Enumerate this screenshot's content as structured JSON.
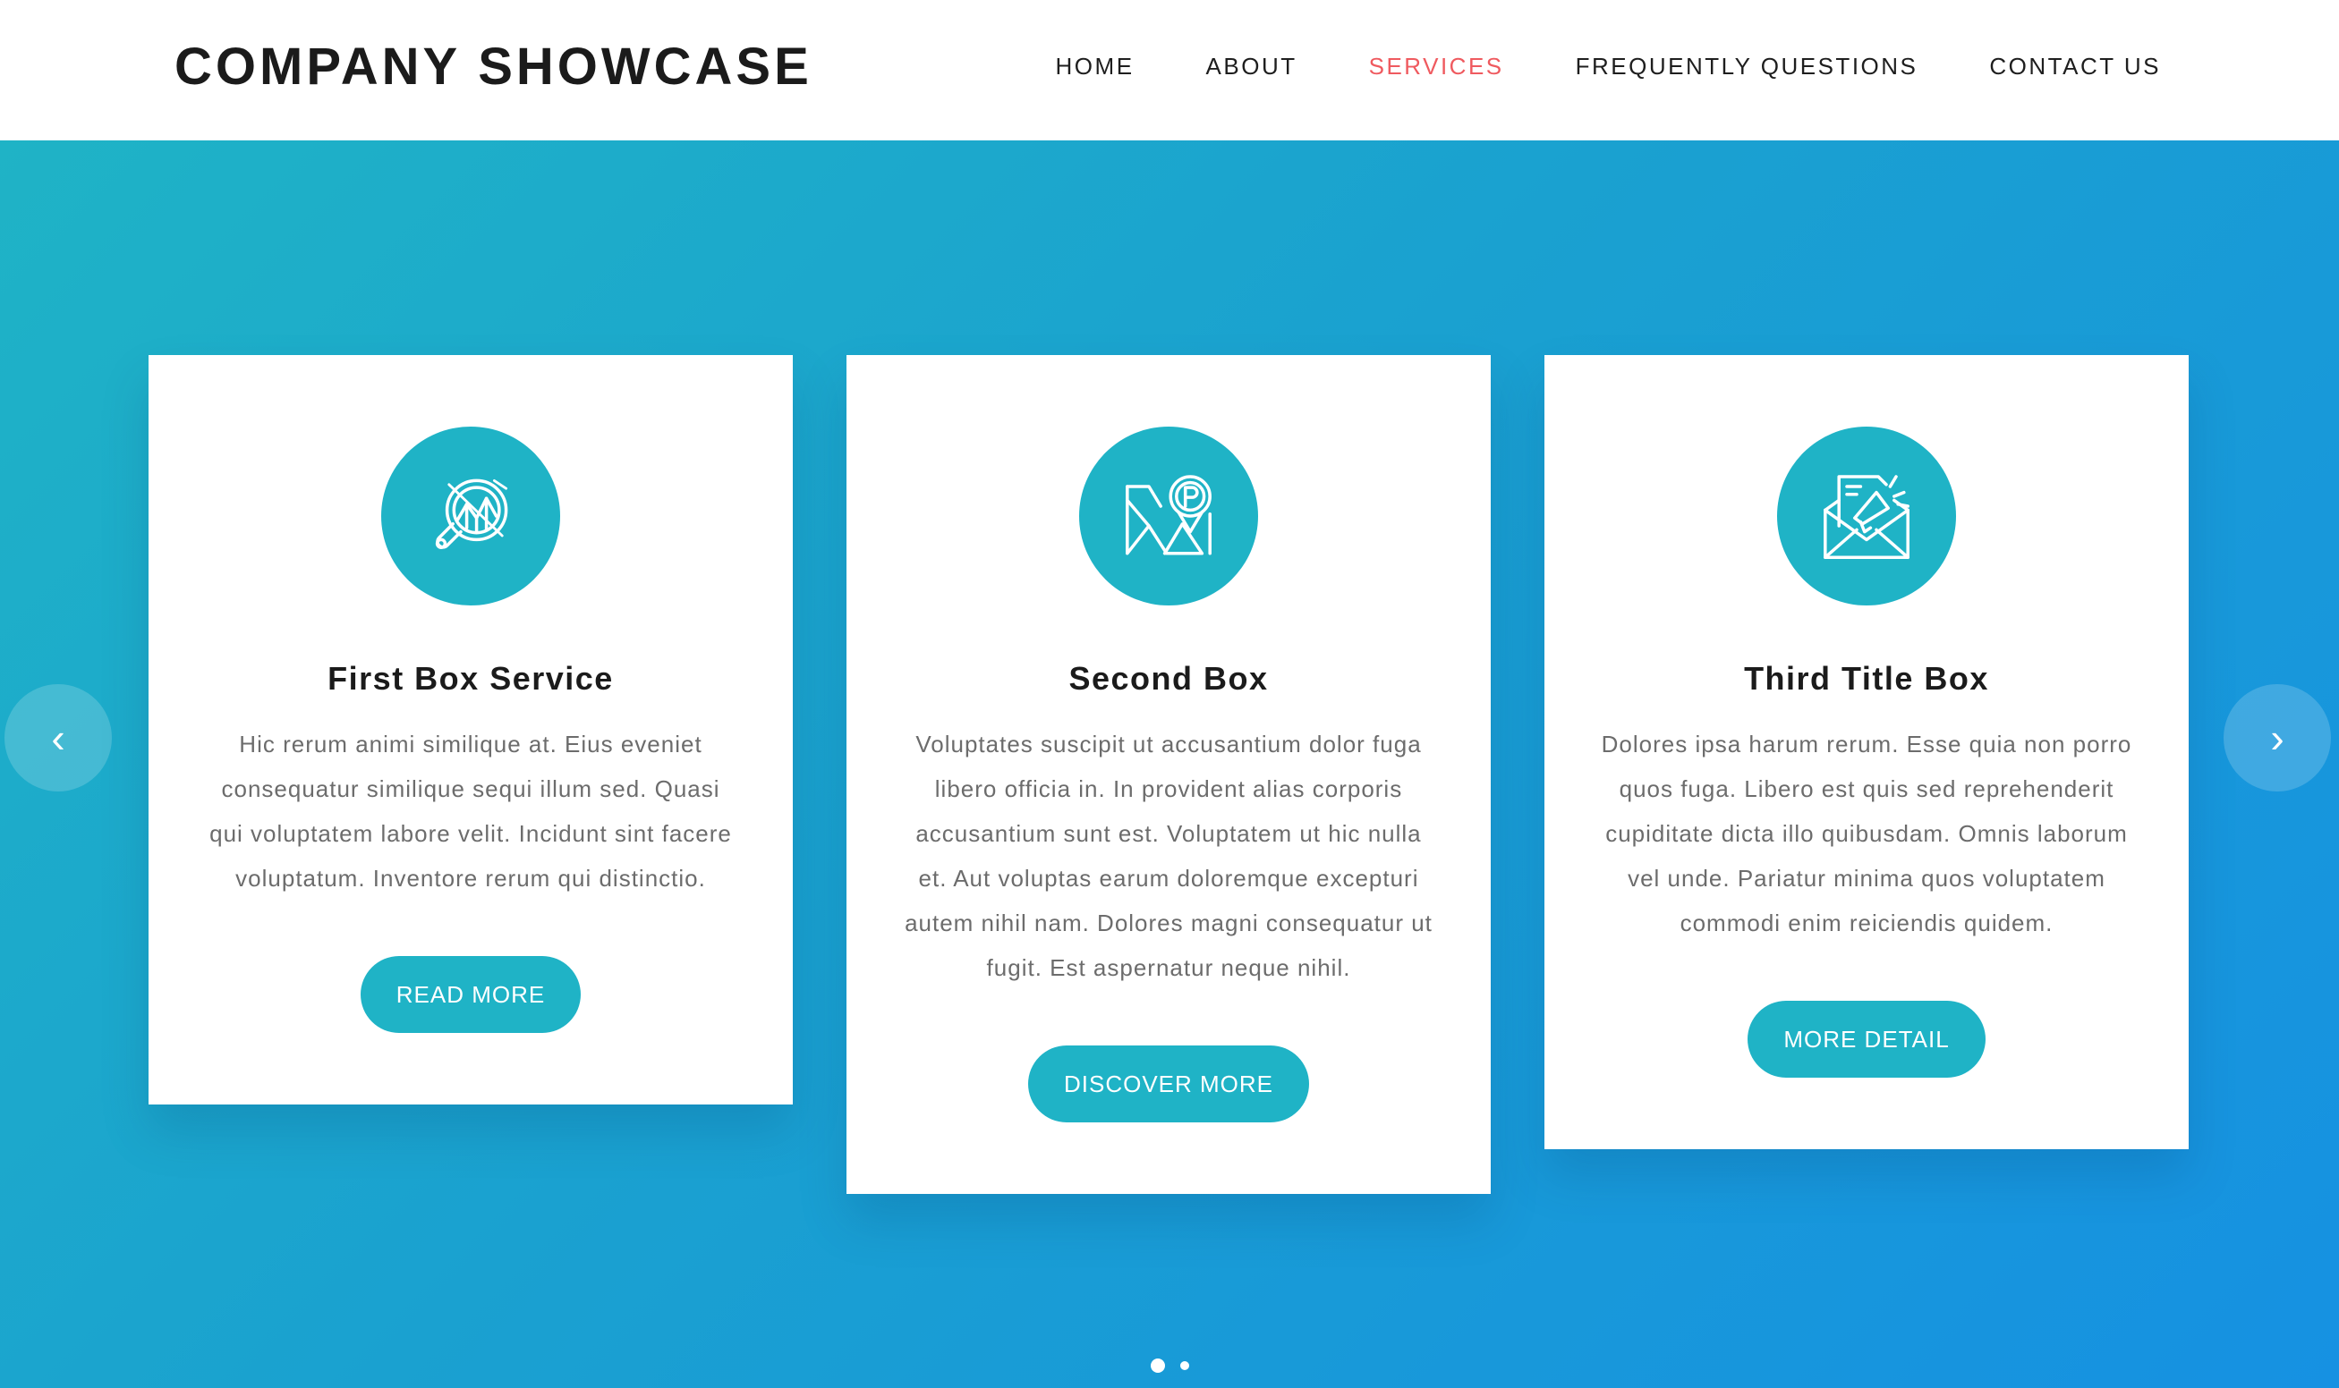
{
  "header": {
    "brand": "COMPANY SHOWCASE",
    "nav": [
      {
        "label": "HOME"
      },
      {
        "label": "ABOUT"
      },
      {
        "label": "SERVICES"
      },
      {
        "label": "FREQUENTLY QUESTIONS"
      },
      {
        "label": "CONTACT US"
      }
    ],
    "active_nav": "SERVICES"
  },
  "colors": {
    "accent": "#1fb3c6",
    "nav_active": "#ef5a5f",
    "gradient_start": "#1fb3c6",
    "gradient_end": "#1691e2"
  },
  "cards": [
    {
      "icon": "search-chart-icon",
      "title": "First Box Service",
      "text": "Hic rerum animi similique at. Eius eveniet consequatur similique sequi illum sed. Quasi qui voluptatem labore velit. Incidunt sint facere voluptatum. Inventore rerum qui distinctio.",
      "button": "READ MORE"
    },
    {
      "icon": "map-parking-icon",
      "title": "Second Box",
      "text": "Voluptates suscipit ut accusantium dolor fuga libero officia in. In provident alias corporis accusantium sunt est. Voluptatem ut hic nulla et. Aut voluptas earum doloremque excepturi autem nihil nam. Dolores magni consequatur ut fugit. Est aspernatur neque nihil.",
      "button": "DISCOVER MORE"
    },
    {
      "icon": "envelope-megaphone-icon",
      "title": "Third Title Box",
      "text": "Dolores ipsa harum rerum. Esse quia non porro quos fuga. Libero est quis sed reprehenderit cupiditate dicta illo quibusdam. Omnis laborum vel unde. Pariatur minima quos voluptatem commodi enim reiciendis quidem.",
      "button": "MORE DETAIL"
    }
  ],
  "carousel": {
    "prev_glyph": "‹",
    "next_glyph": "›",
    "pages": 2,
    "current_page": 1
  }
}
